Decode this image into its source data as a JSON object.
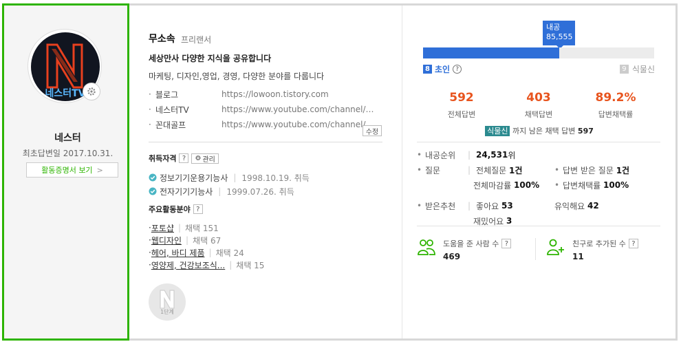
{
  "profile": {
    "nickname": "네스터",
    "last_answer": "최초답변일 2017.10.31.",
    "cert_button": "활동증명서 보기",
    "avatar_text": "네스터TV"
  },
  "intro": {
    "name": "무소속",
    "role": "프리랜서",
    "headline": "세상만사 다양한 지식을 공유합니다",
    "fields": "마케팅, 디자인,영업, 경영, 다양한 분야를 다룹니다",
    "links": [
      {
        "label": "블로그",
        "url": "https://lowoon.tistory.com"
      },
      {
        "label": "네스터TV",
        "url": "https://www.youtube.com/channel/U..."
      },
      {
        "label": "꼰대골프",
        "url": "https://www.youtube.com/channel/U..."
      }
    ],
    "edit": "수정"
  },
  "certs": {
    "title": "취득자격",
    "q": "?",
    "manage": "관리",
    "items": [
      {
        "name": "정보기기운용기능사",
        "date": "1998.10.19. 취득"
      },
      {
        "name": "전자기기기능사",
        "date": "1999.07.26. 취득"
      }
    ]
  },
  "fields": {
    "title": "주요활동분야",
    "q": "?",
    "items": [
      {
        "name": "포토샵",
        "count": "채택 151"
      },
      {
        "name": "웹디자인",
        "count": "채택 67"
      },
      {
        "name": "헤어, 바디 제품",
        "count": "채택 24"
      },
      {
        "name": "영양제, 건강보조식...",
        "count": "채택 15"
      }
    ]
  },
  "level": {
    "label": "1단계"
  },
  "grade": {
    "tip_label": "내공",
    "tip_value": "85,555",
    "progress": 0.59,
    "current_num": "8",
    "current_name": "초인",
    "next_num": "9",
    "next_name": "식물신",
    "q": "?"
  },
  "stats": [
    {
      "value": "592",
      "label": "전체답변"
    },
    {
      "value": "403",
      "label": "채택답변"
    },
    {
      "value": "89.2%",
      "label": "답변채택률"
    }
  ],
  "need": {
    "tag": "식물신",
    "text": "까지 남은 채택 답변",
    "value": "597"
  },
  "info": {
    "rank_label": "내공순위",
    "rank_value": "24,531",
    "rank_unit": "위",
    "question_label": "질문",
    "total_q_label": "전체질문",
    "total_q_value": "1건",
    "received_label": "답변 받은 질문",
    "received_value": "1건",
    "close_rate_label": "전체마감률",
    "close_rate_value": "100%",
    "adopt_rate_label": "답변채택률",
    "adopt_rate_value": "100%",
    "rec_label": "받은추천",
    "like_label": "좋아요",
    "like_value": "53",
    "useful_label": "유익해요",
    "useful_value": "42",
    "fun_label": "재밌어요",
    "fun_value": "3"
  },
  "help": {
    "helped_label": "도움을 준 사람 수",
    "helped_value": "469",
    "friends_label": "친구로 추가된 수",
    "friends_value": "11",
    "q": "?"
  },
  "colors": {
    "green": "#2db400",
    "blue": "#2f6fd8",
    "orange": "#e8541e",
    "teal": "#2b8a8f"
  }
}
